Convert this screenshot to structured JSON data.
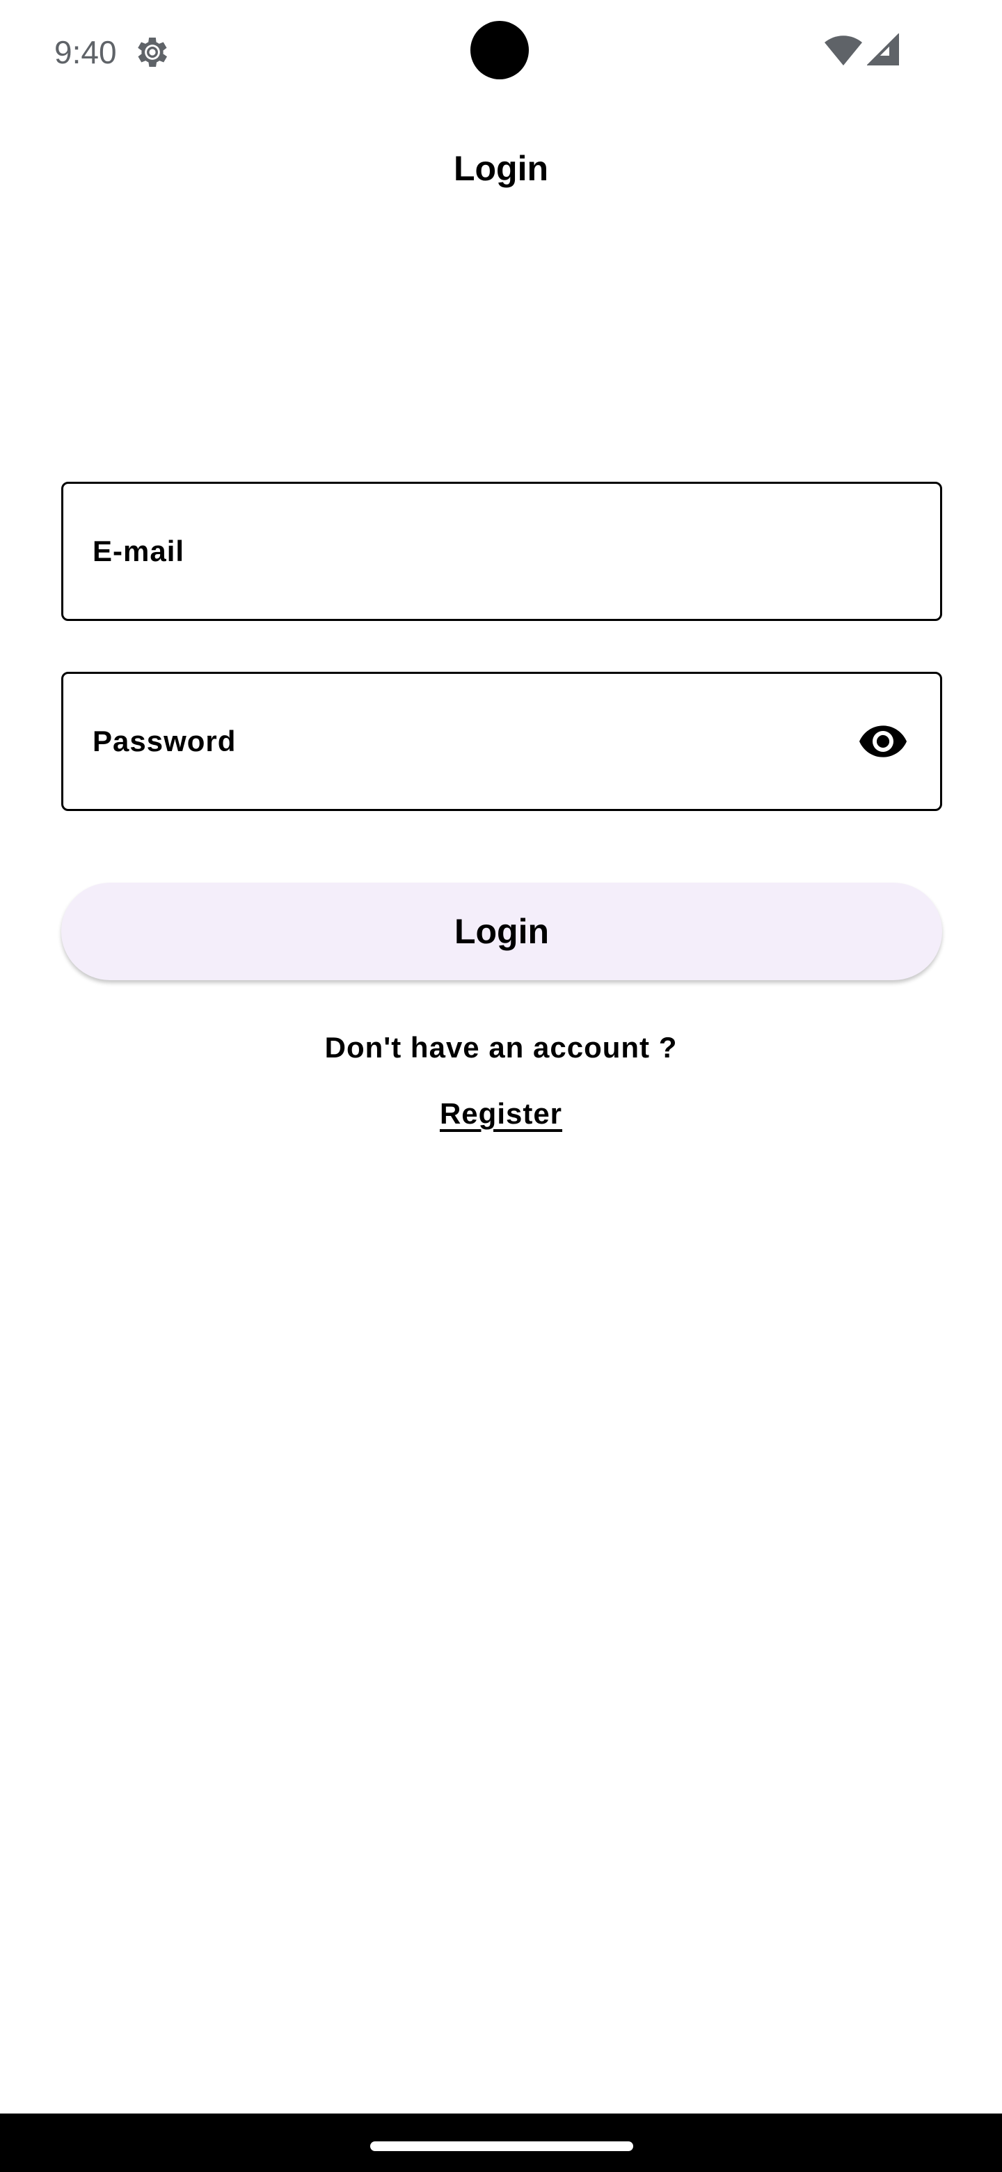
{
  "status_bar": {
    "time": "9:40",
    "settings_icon": "gear-icon",
    "wifi_icon": "wifi-icon",
    "signal_icon": "signal-icon"
  },
  "app_bar": {
    "title": "Login"
  },
  "form": {
    "email_label": "E-mail",
    "email_value": "",
    "password_label": "Password",
    "password_value": "",
    "password_toggle_icon": "eye-icon",
    "login_label": "Login"
  },
  "register": {
    "prompt": "Don't have an account ?",
    "link_label": "Register"
  },
  "colors": {
    "button_background": "#f4eefa",
    "text": "#000000",
    "status_text": "#5f6368",
    "field_border": "#000000"
  }
}
